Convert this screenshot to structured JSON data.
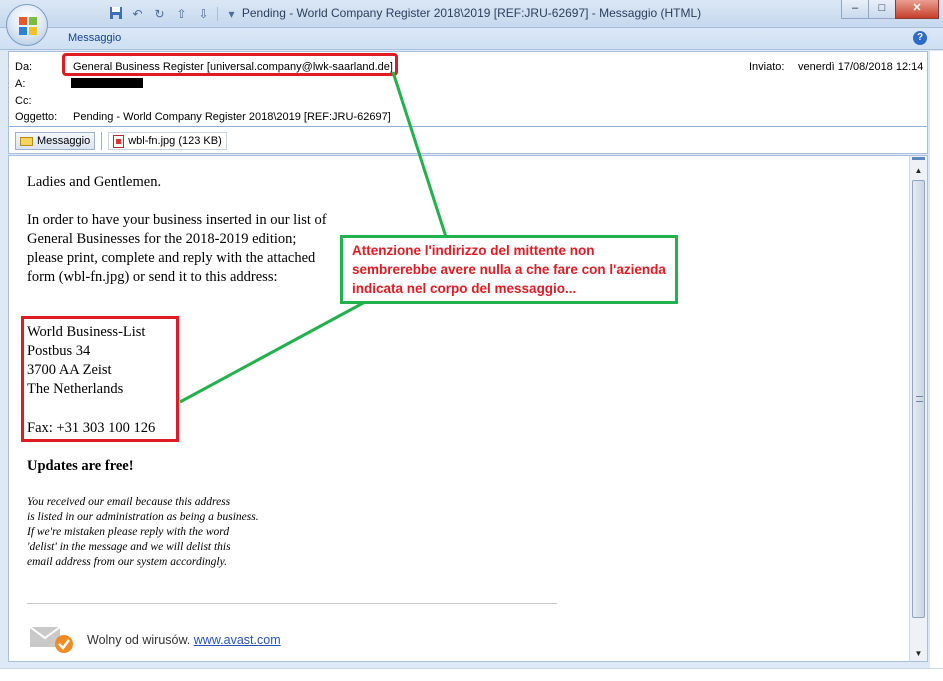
{
  "window": {
    "title": "Pending - World Company Register 2018\\2019 [REF:JRU-62697] - Messaggio (HTML)",
    "minimize": "–",
    "maximize": "□",
    "close": "✕"
  },
  "ribbon": {
    "tab": "Messaggio",
    "help": "?"
  },
  "header": {
    "from_label": "Da:",
    "from_value": "General Business Register [universal.company@lwk-saarland.de]",
    "to_label": "A:",
    "cc_label": "Cc:",
    "subject_label": "Oggetto:",
    "subject_value": "Pending - World Company Register 2018\\2019 [REF:JRU-62697]",
    "sent_label": "Inviato:",
    "sent_value": "venerdì 17/08/2018 12:14"
  },
  "attachments": {
    "message_tab": "Messaggio",
    "file": "wbl-fn.jpg (123 KB)"
  },
  "body": {
    "greeting": "Ladies and Gentlemen.",
    "paragraph": "In order to have your business inserted in our list of General Businesses for the 2018-2019 edition; please print, complete and reply with the attached form (wbl-fn.jpg) or send it to this address:",
    "address": [
      "World Business-List",
      "Postbus 34",
      "3700 AA Zeist",
      "The Netherlands"
    ],
    "fax": "Fax: +31 303 100 126",
    "updates": "Updates are free!",
    "disclaimer": [
      "You received our email because this address",
      "is listed in our administration as being a business.",
      "If we're mistaken please reply with the word",
      "'delist' in the message and we will delist this",
      "email address from our system accordingly."
    ],
    "avast_text": "Wolny od wirusów.",
    "avast_link": "www.avast.com"
  },
  "annotation": {
    "note": "Attenzione l'indirizzo del mittente non sembrerebbe avere nulla a che fare con l'azienda indicata nel corpo del messaggio...",
    "colors": {
      "red": "#e01b24",
      "green": "#22b14c"
    }
  },
  "icons": [
    "office-button-icon",
    "save-icon",
    "undo-icon",
    "redo-icon",
    "up-icon",
    "down-icon",
    "help-icon",
    "envelope-icon",
    "jpg-file-icon",
    "avast-icon"
  ]
}
